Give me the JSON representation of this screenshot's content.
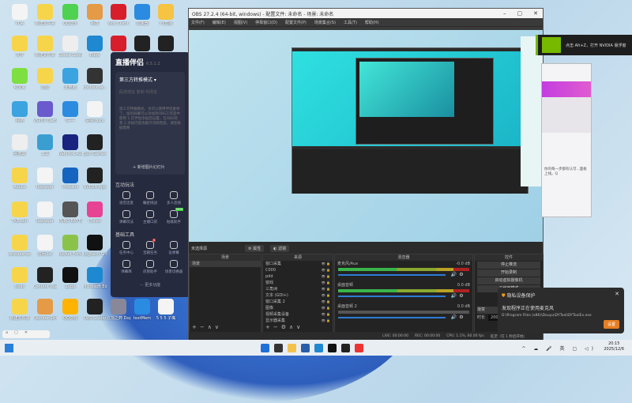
{
  "desktop_icons": [
    {
      "label": "PDA",
      "color": "#f4f4f4"
    },
    {
      "label": "新建文件夹",
      "color": "#f7d54a"
    },
    {
      "label": "QQ音乐",
      "color": "#4fd24f"
    },
    {
      "label": "柯基",
      "color": "#e59a45"
    },
    {
      "label": "Nox Client",
      "color": "#d81e2a"
    },
    {
      "label": "加速器",
      "color": "#2a8be0"
    },
    {
      "label": "YY直播",
      "color": "#f6c342"
    },
    {
      "label": "文件",
      "color": "#f7d54a"
    },
    {
      "label": "新建文件夹",
      "color": "#f7d54a"
    },
    {
      "label": "Goose Goose Duck",
      "color": "#eee"
    },
    {
      "label": "Edge",
      "color": "#1e88d0"
    },
    {
      "label": "Nox",
      "color": "#d81e2a"
    },
    {
      "label": "OBS",
      "color": "#222"
    },
    {
      "label": "相机",
      "color": "#222"
    },
    {
      "label": "KOOK",
      "color": "#7ee040"
    },
    {
      "label": "游戏",
      "color": "#f7d54a"
    },
    {
      "label": "此电脑",
      "color": "#3aa3e0"
    },
    {
      "label": "content_w...",
      "color": "#333"
    },
    {
      "label": "网络",
      "color": "#3aa3e0"
    },
    {
      "label": "VSPDP Demo",
      "color": "#6a5acd"
    },
    {
      "label": "G++",
      "color": "#2a8be0"
    },
    {
      "label": "说明.docx",
      "color": "#f4f4f4"
    },
    {
      "label": "回收站",
      "color": "#eee"
    },
    {
      "label": "工具",
      "color": "#3a9fd0"
    },
    {
      "label": "Nahimic Audio",
      "color": "#1a237e"
    },
    {
      "label": "Epic Games Launcher",
      "color": "#222"
    },
    {
      "label": "Adobe",
      "color": "#f7d54a"
    },
    {
      "label": "Replayer",
      "color": "#f4f4f4"
    },
    {
      "label": "Protocol",
      "color": "#1565c0"
    },
    {
      "label": "NVIDIA App",
      "color": "#222"
    },
    {
      "label": "TKE_Bin",
      "color": "#f7d54a"
    },
    {
      "label": "Replayer",
      "color": "#f4f4f4"
    },
    {
      "label": "PUBG BATTLEGROUNDS",
      "color": "#555"
    },
    {
      "label": "iTunes",
      "color": "#e84393"
    },
    {
      "label": "Afterburner",
      "color": "#f7d54a"
    },
    {
      "label": "说明.txt",
      "color": "#f4f4f4"
    },
    {
      "label": "Rocket Fortress",
      "color": "#8bc34a"
    },
    {
      "label": "Logitech G HUB",
      "color": "#111"
    },
    {
      "label": "tools",
      "color": "#f7d54a"
    },
    {
      "label": "Content Warning",
      "color": "#222"
    },
    {
      "label": "Zepp",
      "color": "#111"
    },
    {
      "label": "Microsoft Edge",
      "color": "#1e88d0"
    },
    {
      "label": "新建文件夹",
      "color": "#f7d54a"
    },
    {
      "label": "Counter-Strike Global Offensive",
      "color": "#e59a45"
    },
    {
      "label": "QQ游戏",
      "color": "#ffb300"
    },
    {
      "label": "OBS Studio",
      "color": "#222"
    },
    {
      "label": "云顶之弈 Dopoplo",
      "color": "#889"
    },
    {
      "label": "textMem",
      "color": "#2a8be0"
    },
    {
      "label": "5 5 5 子嘴",
      "color": "#f4f4f4"
    }
  ],
  "zhibo": {
    "title": "直播伴侣",
    "version": "6.5.1.2",
    "mode": "第三方转推模式 ▾",
    "tabs": "码流地址  复制  可改名",
    "desc": "第三方转推模式，也可以使用伴侣素材了，加的屏幕可以添加到OBS工作室中使用 1.在伴侣添加后设置，在OBS场景 2.添加内容会额外消耗性能，请您根据需要",
    "add": "+ 新增图片幻灯片",
    "sec1": "互动玩法",
    "interact": [
      "语音连麦",
      "瞩星挑战",
      "多人连线",
      "弹幕玩法",
      "主播口袋",
      "贴纸助手"
    ],
    "new_badge": "NEW",
    "sec2": "基础工具",
    "tools": [
      "任务中心",
      "宝箱任务",
      "设弹幕",
      "弹幕库",
      "房管助手",
      "场景切换器"
    ],
    "badge_count": "5",
    "more": "··· 更多功能"
  },
  "obs": {
    "title": "OBS 27.2.4 (64-bit, windows) - 配置文件: 未命名 - 场景: 未命名",
    "menu": [
      "文件(F)",
      "编辑(E)",
      "视图(V)",
      "停靠窗口(D)",
      "配置文件(P)",
      "场景集合(S)",
      "工具(T)",
      "帮助(H)"
    ],
    "source_label": "未选择源",
    "properties": "属性",
    "filters": "滤镜",
    "scenes_header": "场景",
    "scenes": [
      "场景"
    ],
    "sources_header": "来源",
    "sources": [
      "窗口采集",
      "C000",
      "pdd",
      "窗戏",
      "三角洲",
      "文本 (GDI+)",
      "窗口采集 2",
      "图像",
      "视频采集设备",
      "显示器采集"
    ],
    "mixer_header": "混音器",
    "mixer": [
      {
        "name": "麦克风/Aux",
        "db": "-0.0 dB",
        "muted": false
      },
      {
        "name": "桌面音频",
        "db": "0.0 dB",
        "muted": false
      },
      {
        "name": "桌面音频 2",
        "db": "0.0 dB",
        "muted": true
      }
    ],
    "controls_header": "控件",
    "controls": [
      "停止推流",
      "开始录制",
      "启动虚拟摄像机",
      "工作室模式"
    ],
    "transition": "渐变",
    "duration_label": "时长",
    "duration": "20000",
    "status": {
      "live": "LIVE: 00:00:00",
      "rec": "REC: 00:00:00",
      "cpu": "CPU: 1.1%, 60.00 fps",
      "delay": "延迟（在 1 秒后开始）"
    }
  },
  "nvidia": {
    "message": "点击 Alt+Z，打开 NVIDIA 悬浮窗",
    "accent": "#76b900"
  },
  "side_panel": {
    "text": "你的每一步都有认可...面板上线。Q"
  },
  "privacy": {
    "title": "隐私设备保护",
    "message": "发现程序正在使用麦克风",
    "path": "D:\\Program Files (x86)\\Douyu\\DYTool\\DYToolEx.exe",
    "button": "设置"
  },
  "clock": {
    "time": "20:15",
    "date": "2025/12/6"
  },
  "tray": "^ ☁ 🎤 英 ▢ ◁)"
}
